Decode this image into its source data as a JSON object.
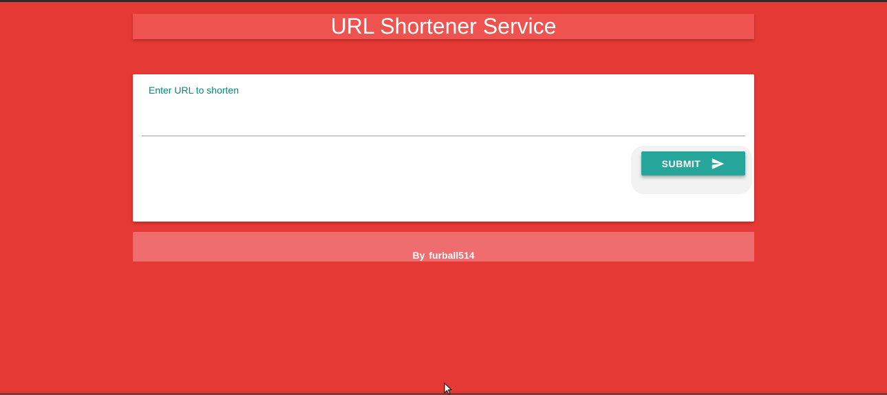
{
  "header": {
    "title": "URL Shortener Service"
  },
  "form": {
    "label": "Enter URL to shorten",
    "value": "",
    "submit_label": "SUBMIT",
    "submit_icon": "send-icon"
  },
  "footer": {
    "prefix": "By",
    "author": "furball514"
  },
  "colors": {
    "background": "#e53935",
    "header": "#ef5350",
    "footer": "#ef6c6f",
    "accent": "#26a69a",
    "label": "#00897b"
  }
}
